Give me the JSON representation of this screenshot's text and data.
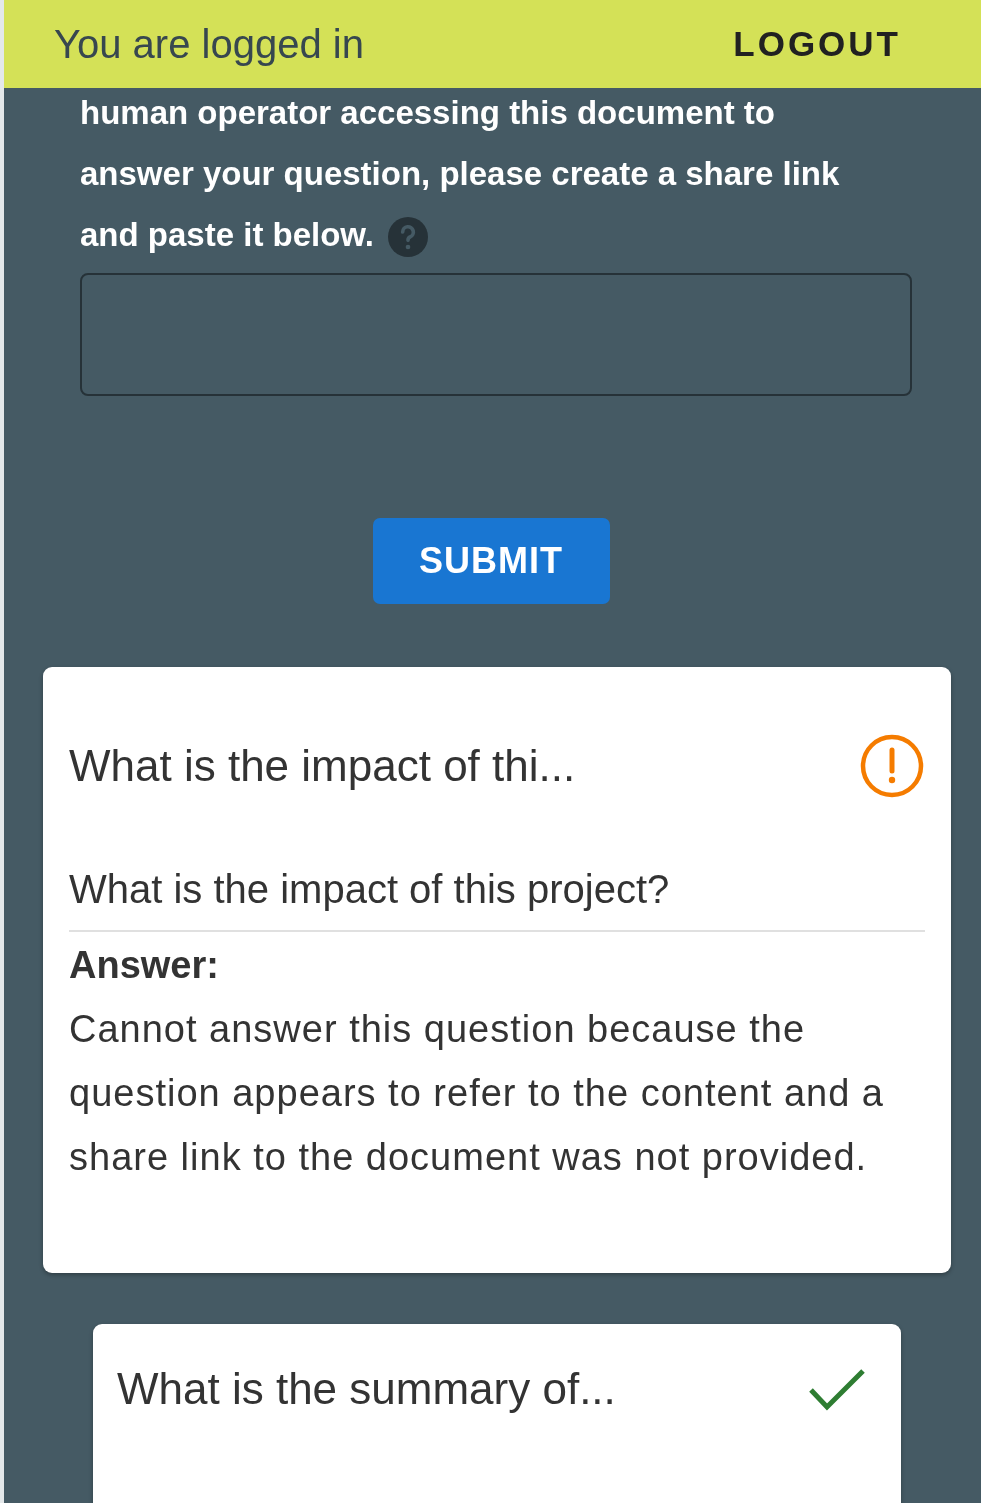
{
  "header": {
    "status": "You are logged in",
    "logout": "LOGOUT"
  },
  "share": {
    "instructions": "human operator accessing this document to answer your question, please create a share link and paste it below."
  },
  "submit": "SUBMIT",
  "cards": [
    {
      "title": "What is the impact of thi...",
      "kind": "warning",
      "question": "What is the impact of this project?",
      "answer_label": "Answer:",
      "answer": "Cannot answer this question because the question appears to refer to the content and a share link to the document was not provided."
    },
    {
      "title": "What is the summary of...",
      "kind": "done"
    }
  ]
}
